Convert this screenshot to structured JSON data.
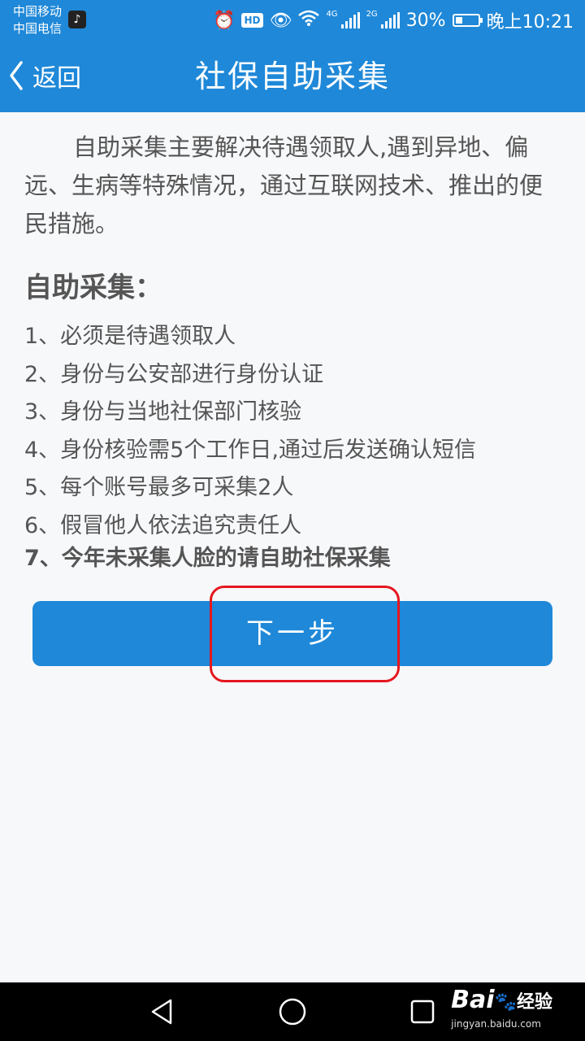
{
  "status": {
    "carrier_1": "中国移动",
    "carrier_2": "中国电信",
    "hd": "HD",
    "net_1": "4G",
    "net_2": "2G",
    "battery": "30%",
    "time": "晚上10:21"
  },
  "header": {
    "back_label": "返回",
    "title": "社保自助采集"
  },
  "intro": "自助采集主要解决待遇领取人,遇到异地、偏远、生病等特殊情况，通过互联网技术、推出的便民措施。",
  "section_title": "自助采集：",
  "rules": [
    "1、必须是待遇领取人",
    "2、身份与公安部进行身份认证",
    "3、身份与当地社保部门核验",
    "4、身份核验需5个工作日,通过后发送确认短信",
    "5、每个账号最多可采集2人",
    "6、假冒他人依法追究责任人",
    "7、今年未采集人脸的请自助社保采集"
  ],
  "next_button": "下一步",
  "watermark": {
    "logo": "Bai",
    "logo_cn": "经验",
    "url": "jingyan.baidu.com"
  },
  "colors": {
    "primary": "#1f88d8",
    "highlight": "#e5171f",
    "text": "#555555",
    "background": "#f7f8fa"
  }
}
